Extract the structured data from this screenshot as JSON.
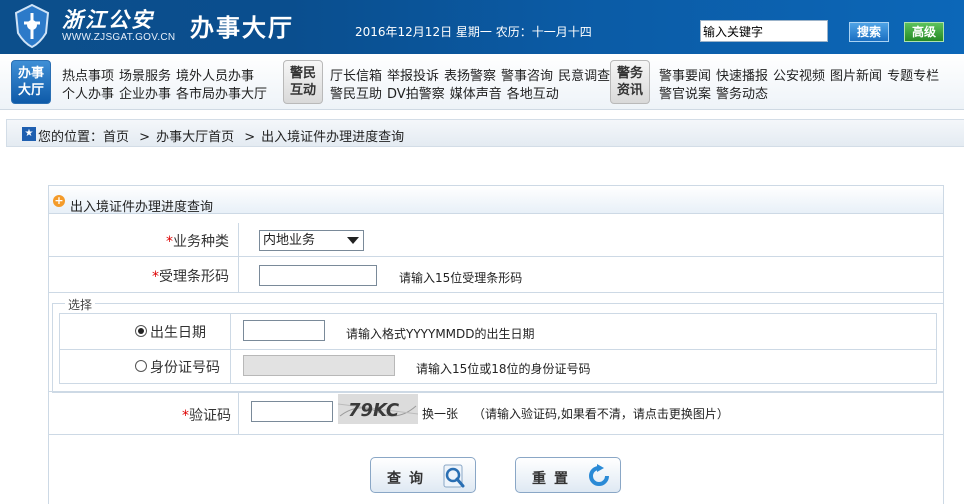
{
  "header": {
    "logo_text": "浙江公安",
    "site_url": "WWW.ZJSGAT.GOV.CN",
    "hall_title": "办事大厅",
    "date_text": "2016年12月12日 星期一 农历：十一月十四",
    "search_placeholder": "输入关键字",
    "search_button": "搜索",
    "advanced_button": "高级"
  },
  "nav": {
    "hall_box": "办事大厅",
    "hall_row1": [
      "热点事项",
      "场景服务",
      "境外人员办事"
    ],
    "hall_row2": [
      "个人办事",
      "企业办事",
      "各市局办事大厅"
    ],
    "interact_box": "警民互动",
    "interact_row1": [
      "厅长信箱",
      "举报投诉",
      "表扬警察",
      "警事咨询",
      "民意调查"
    ],
    "interact_row2": [
      "警民互助",
      "DV拍警察",
      "媒体声音",
      "各地互动"
    ],
    "news_box": "警务资讯",
    "news_row1": [
      "警事要闻",
      "快速播报",
      "公安视频",
      "图片新闻",
      "专题专栏"
    ],
    "news_row2": [
      "警官说案",
      "警务动态"
    ]
  },
  "breadcrumb": {
    "prefix": "您的位置：",
    "items": [
      "首页",
      "办事大厅首页",
      "出入境证件办理进度查询"
    ],
    "separator": ">"
  },
  "form": {
    "title": "出入境证件办理进度查询",
    "required_mark": "*",
    "business_type": {
      "label": "业务种类",
      "value": "内地业务"
    },
    "barcode": {
      "label": "受理条形码",
      "value": "",
      "hint": "请输入15位受理条形码"
    },
    "choice_legend": "选择",
    "birthdate": {
      "label": "出生日期",
      "selected": true,
      "value": "",
      "hint": "请输入格式YYYYMMDD的出生日期"
    },
    "id_number": {
      "label": "身份证号码",
      "selected": false,
      "value": "",
      "hint": "请输入15位或18位的身份证号码"
    },
    "captcha": {
      "label": "验证码",
      "value": "",
      "image_text": "79KC",
      "refresh_text": "换一张",
      "hint": "（请输入验证码,如果看不清，请点击更换图片）"
    },
    "query_button": "查询",
    "reset_button": "重置"
  },
  "colors": {
    "header_blue": "#0c5aa0",
    "required_red": "#d00000",
    "search_blue": "#2a7fd0",
    "advanced_green": "#2f9a2f"
  }
}
